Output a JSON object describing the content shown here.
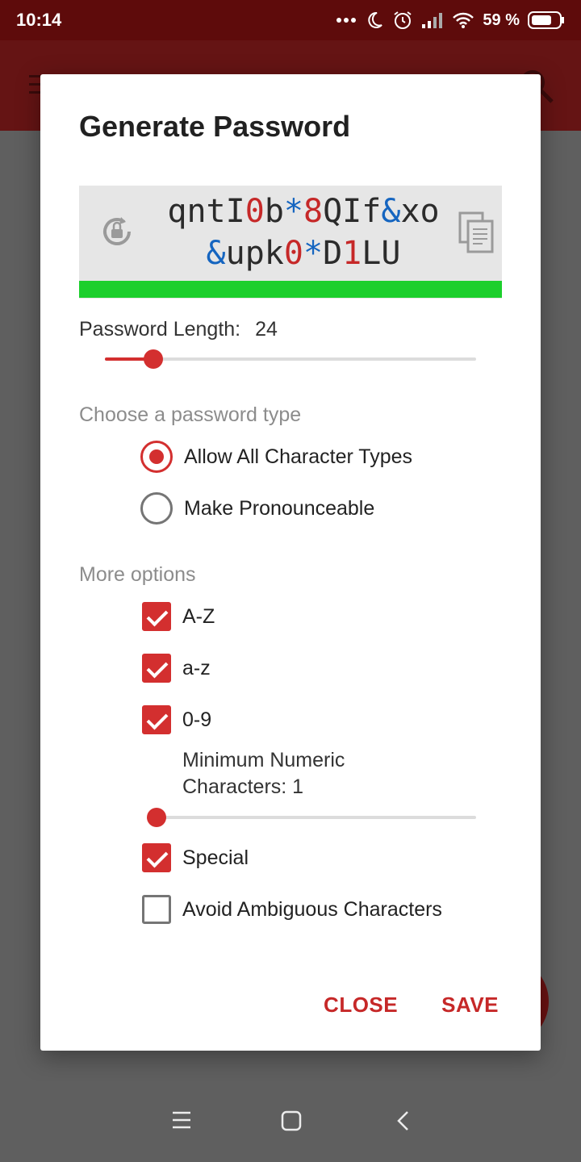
{
  "status_bar": {
    "time": "10:14",
    "battery_text": "59 %"
  },
  "dialog": {
    "title": "Generate Password",
    "password": {
      "line1": [
        {
          "t": "qntI",
          "k": "let"
        },
        {
          "t": "0",
          "k": "num"
        },
        {
          "t": "b",
          "k": "let"
        },
        {
          "t": "*",
          "k": "sym"
        },
        {
          "t": "8",
          "k": "num"
        },
        {
          "t": "QIf",
          "k": "let"
        },
        {
          "t": "&",
          "k": "sym"
        },
        {
          "t": "xo",
          "k": "let"
        }
      ],
      "line2": [
        {
          "t": "&",
          "k": "sym"
        },
        {
          "t": "upk",
          "k": "let"
        },
        {
          "t": "0",
          "k": "num"
        },
        {
          "t": "*",
          "k": "sym"
        },
        {
          "t": "D",
          "k": "let"
        },
        {
          "t": "1",
          "k": "num"
        },
        {
          "t": "LU",
          "k": "let"
        }
      ],
      "strength_color": "#1ccf2c"
    },
    "length_label": "Password Length:",
    "length_value": "24",
    "length_slider_fraction": 0.13,
    "type_section_label": "Choose a password type",
    "type_options": [
      {
        "label": "Allow All Character Types",
        "selected": true
      },
      {
        "label": "Make Pronounceable",
        "selected": false
      }
    ],
    "more_section_label": "More options",
    "checkboxes": {
      "upper": {
        "label": "A-Z",
        "checked": true
      },
      "lower": {
        "label": "a-z",
        "checked": true
      },
      "digits": {
        "label": "0-9",
        "checked": true
      },
      "special": {
        "label": "Special",
        "checked": true
      },
      "ambiguous": {
        "label": "Avoid Ambiguous Characters",
        "checked": false
      }
    },
    "min_numeric_label": "Minimum Numeric Characters: 1",
    "min_numeric_slider_fraction": 0.0,
    "actions": {
      "close": "CLOSE",
      "save": "SAVE"
    }
  },
  "colors": {
    "accent": "#d32f2f",
    "status_bar": "#5e0b0b"
  },
  "icons": {
    "refresh": "refresh-lock-icon",
    "copy": "copy-icon",
    "menu": "hamburger-menu-icon",
    "search": "search-icon"
  }
}
